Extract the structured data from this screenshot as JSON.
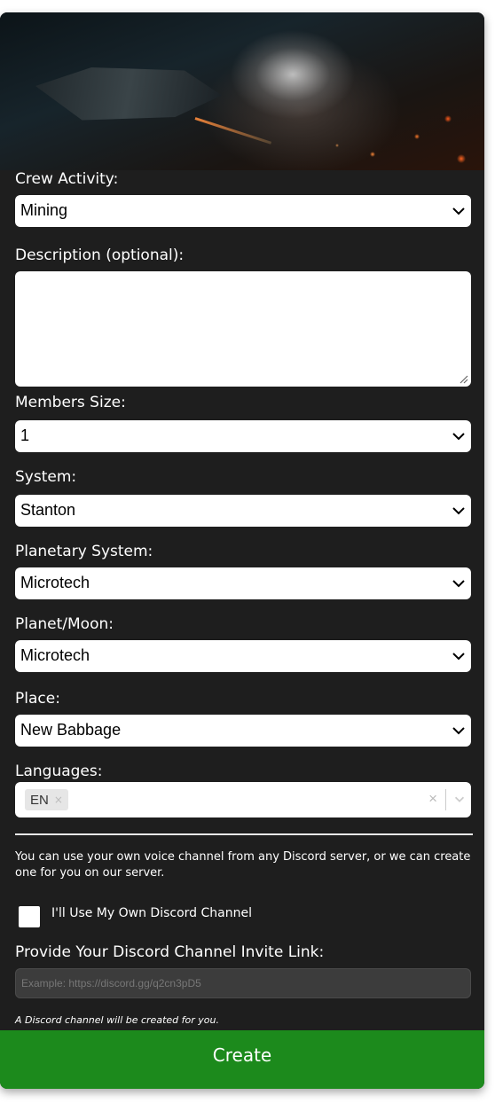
{
  "form": {
    "crew_activity": {
      "label": "Crew Activity:",
      "value": "Mining"
    },
    "description": {
      "label": "Description (optional):",
      "value": ""
    },
    "members_size": {
      "label": "Members Size:",
      "value": "1"
    },
    "system": {
      "label": "System:",
      "value": "Stanton"
    },
    "planetary_system": {
      "label": "Planetary System:",
      "value": "Microtech"
    },
    "planet_moon": {
      "label": "Planet/Moon:",
      "value": "Microtech"
    },
    "place": {
      "label": "Place:",
      "value": "New Babbage"
    },
    "languages": {
      "label": "Languages:",
      "selected": [
        "EN"
      ],
      "chip_remove": "×",
      "clear": "×"
    }
  },
  "discord": {
    "info": "You can use your own voice channel from any Discord server, or we can create one for you on our server.",
    "own_channel_label": "I'll Use My Own Discord Channel",
    "own_channel_checked": false,
    "invite_label": "Provide Your Discord Channel Invite Link:",
    "invite_placeholder": "Example: https://discord.gg/q2cn3pD5",
    "note": "A Discord channel will be created for you."
  },
  "actions": {
    "create_label": "Create"
  },
  "colors": {
    "panel": "#1e1e1e",
    "create_button": "#1c8a1c",
    "text": "#ffffff"
  }
}
